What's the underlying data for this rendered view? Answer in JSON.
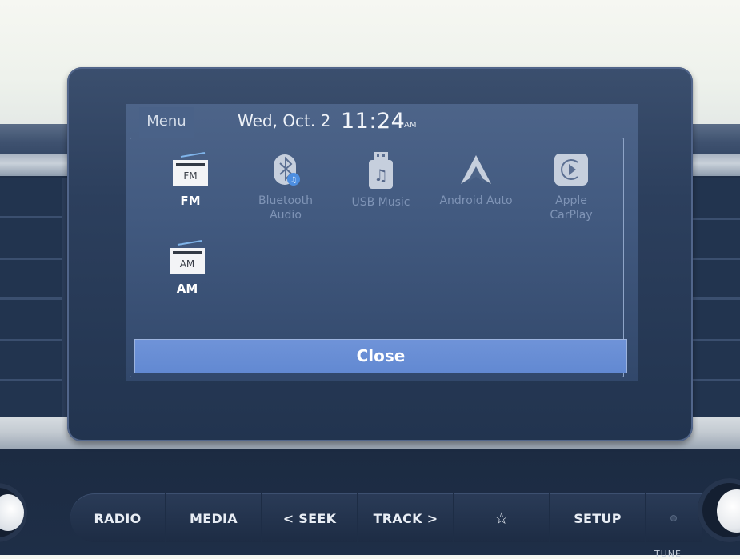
{
  "header": {
    "menu_label": "Menu",
    "date": "Wed, Oct. 2",
    "time": "11:24",
    "ampm": "AM"
  },
  "apps": [
    {
      "label": "FM",
      "icon": "fm-radio-icon",
      "enabled": true
    },
    {
      "label": "Bluetooth Audio",
      "label_lines": [
        "Bluetooth",
        "Audio"
      ],
      "icon": "bluetooth-audio-icon",
      "enabled": false
    },
    {
      "label": "USB Music",
      "icon": "usb-music-icon",
      "enabled": false
    },
    {
      "label": "Android Auto",
      "icon": "android-auto-icon",
      "enabled": false
    },
    {
      "label": "Apple CarPlay",
      "label_lines": [
        "Apple",
        "CarPlay"
      ],
      "icon": "apple-carplay-icon",
      "enabled": false
    },
    {
      "label": "AM",
      "icon": "am-radio-icon",
      "enabled": true
    }
  ],
  "icon_text": {
    "fm": "FM",
    "am": "AM"
  },
  "close_label": "Close",
  "hardware_buttons": [
    {
      "label": "RADIO"
    },
    {
      "label": "MEDIA"
    },
    {
      "label": "< SEEK"
    },
    {
      "label": "TRACK >"
    },
    {
      "label": "☆",
      "icon": "star-favorite-icon"
    },
    {
      "label": "SETUP"
    }
  ],
  "tune_label": "TUNE",
  "colors": {
    "screen_bg": "#425a80",
    "close_button": "#6a8fd6",
    "disabled_label": "#7f94b6",
    "enabled_label": "#ffffff"
  }
}
